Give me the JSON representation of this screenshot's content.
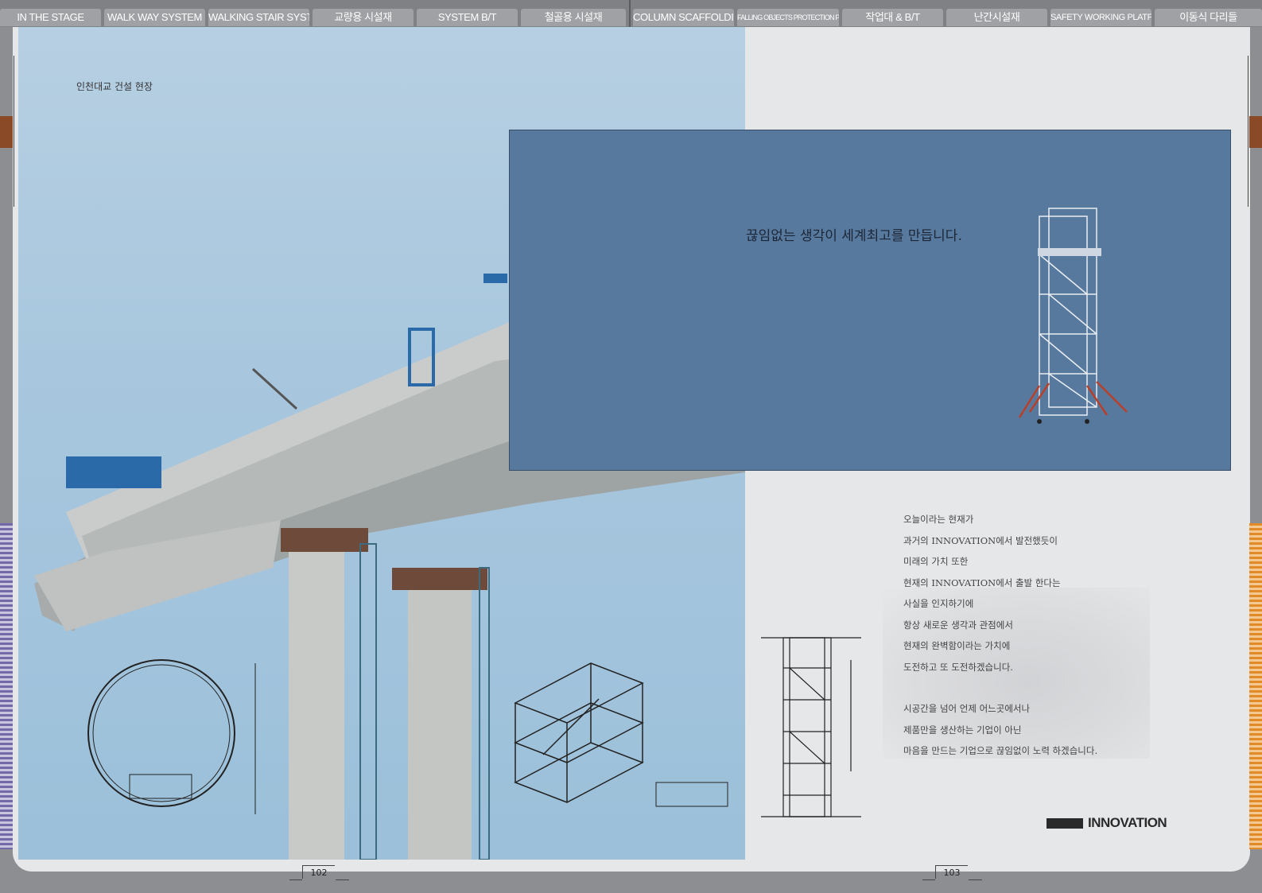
{
  "nav": {
    "tabs": [
      "IN THE STAGE",
      "WALK WAY SYSTEM",
      "WALKING STAIR SYSTEM",
      "교량용 시설재",
      "SYSTEM B/T",
      "철골용 시설재",
      "COLUMN SCAFFOLDING",
      "FALLING OBJECTS PROTECTION PLATFORM",
      "작업대 & B/T",
      "난간시설재",
      "SAFETY WORKING PLATFORM",
      "이동식 다리들"
    ]
  },
  "left_page": {
    "caption": "인천대교 건설 현장",
    "page_number": "102"
  },
  "right_page": {
    "slogan": "끊임없는 생각이 세계최고를 만듭니다.",
    "body_lines_1": [
      "오늘이라는 현재가",
      "과거의 INNOVATION에서 발전했듯이",
      "미래의 가치 또한",
      "현재의 INNOVATION에서 출발 한다는",
      "사실을 인지하기에",
      "항상 새로운 생각과 관점에서",
      "현재의 완벽함이라는 가치에",
      "도전하고 또 도전하겠습니다."
    ],
    "body_lines_2": [
      "시공간을 넘어 언제 어느곳에서나",
      "제품만을 생산하는 기업이 아닌",
      "마음을 만드는 기업으로 끊임없이 노력 하겠습니다."
    ],
    "logo_text": "INNOVATION",
    "page_number": "103"
  },
  "colors": {
    "panel_blue": "#58799e",
    "sky": "#a8c7de",
    "page_bg": "#e6e7e9"
  }
}
